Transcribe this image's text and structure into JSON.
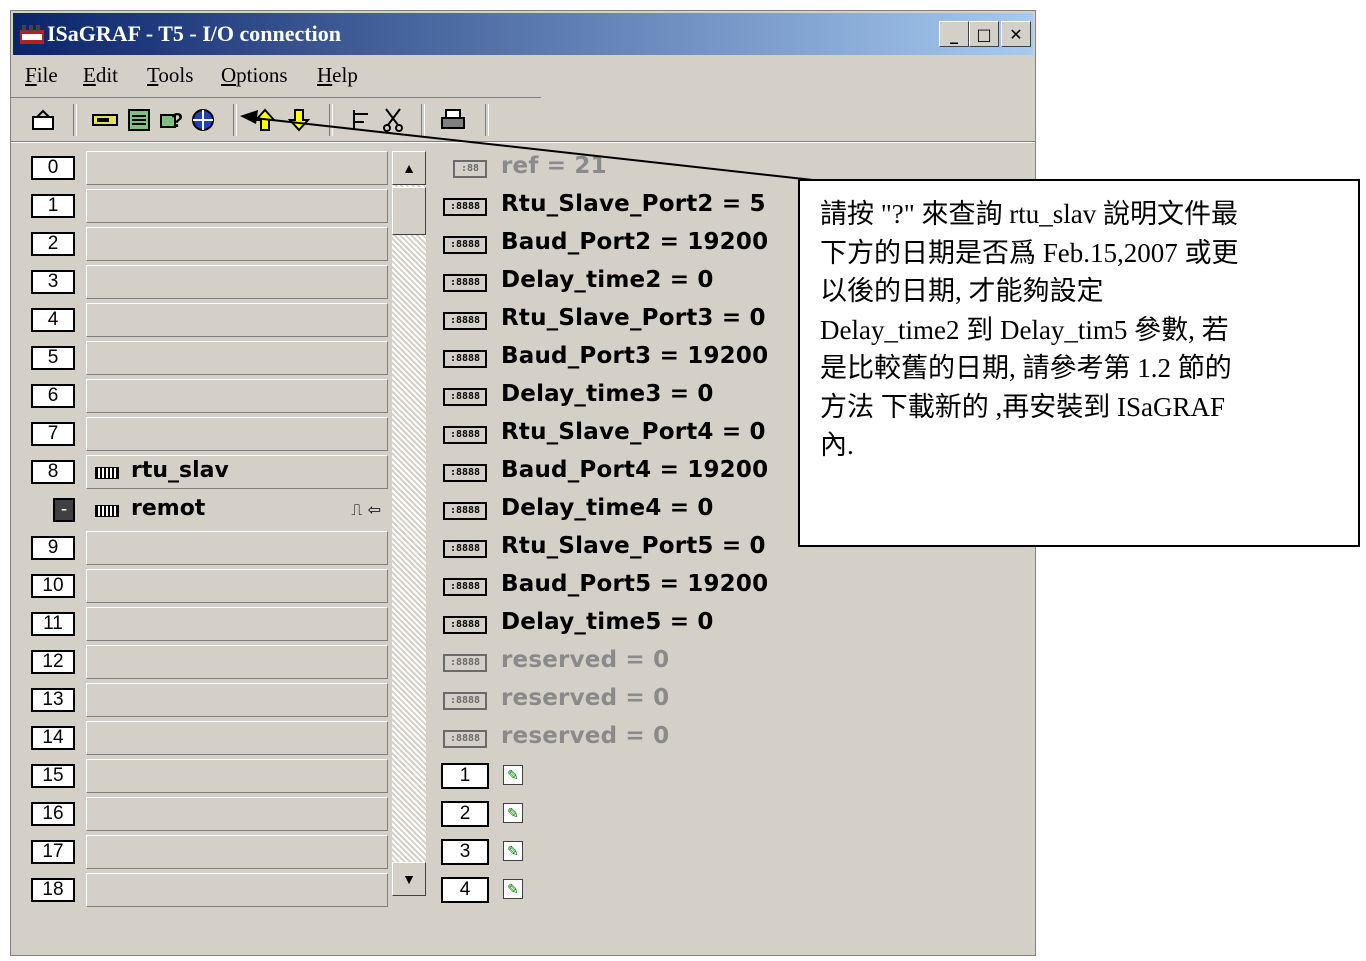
{
  "window": {
    "title": "ISaGRAF - T5 - I/O connection",
    "minimize": "_",
    "maximize": "□",
    "close": "✕"
  },
  "menu": [
    "File",
    "Edit",
    "Tools",
    "Options",
    "Help"
  ],
  "slots": [
    {
      "num": "0",
      "label": ""
    },
    {
      "num": "1",
      "label": ""
    },
    {
      "num": "2",
      "label": ""
    },
    {
      "num": "3",
      "label": ""
    },
    {
      "num": "4",
      "label": ""
    },
    {
      "num": "5",
      "label": ""
    },
    {
      "num": "6",
      "label": ""
    },
    {
      "num": "7",
      "label": ""
    },
    {
      "num": "8",
      "label": "rtu_slav"
    },
    {
      "num": "-",
      "label": "remot"
    },
    {
      "num": "9",
      "label": ""
    },
    {
      "num": "10",
      "label": ""
    },
    {
      "num": "11",
      "label": ""
    },
    {
      "num": "12",
      "label": ""
    },
    {
      "num": "13",
      "label": ""
    },
    {
      "num": "14",
      "label": ""
    },
    {
      "num": "15",
      "label": ""
    },
    {
      "num": "16",
      "label": ""
    },
    {
      "num": "17",
      "label": ""
    },
    {
      "num": "18",
      "label": ""
    }
  ],
  "params": [
    {
      "text": "ref = 21",
      "gray": true,
      "icon": ":88"
    },
    {
      "text": "Rtu_Slave_Port2 = 5",
      "gray": false,
      "icon": ":8888"
    },
    {
      "text": "Baud_Port2 = 19200",
      "gray": false,
      "icon": ":8888"
    },
    {
      "text": "Delay_time2 = 0",
      "gray": false,
      "icon": ":8888"
    },
    {
      "text": "Rtu_Slave_Port3 = 0",
      "gray": false,
      "icon": ":8888"
    },
    {
      "text": "Baud_Port3 = 19200",
      "gray": false,
      "icon": ":8888"
    },
    {
      "text": "Delay_time3 = 0",
      "gray": false,
      "icon": ":8888"
    },
    {
      "text": "Rtu_Slave_Port4 = 0",
      "gray": false,
      "icon": ":8888"
    },
    {
      "text": "Baud_Port4 = 19200",
      "gray": false,
      "icon": ":8888"
    },
    {
      "text": "Delay_time4 = 0",
      "gray": false,
      "icon": ":8888"
    },
    {
      "text": "Rtu_Slave_Port5 = 0",
      "gray": false,
      "icon": ":8888"
    },
    {
      "text": "Baud_Port5 = 19200",
      "gray": false,
      "icon": ":8888"
    },
    {
      "text": "Delay_time5 = 0",
      "gray": false,
      "icon": ":8888"
    },
    {
      "text": "reserved = 0",
      "gray": true,
      "icon": ":8888"
    },
    {
      "text": "reserved = 0",
      "gray": true,
      "icon": ":8888"
    },
    {
      "text": "reserved = 0",
      "gray": true,
      "icon": ":8888"
    }
  ],
  "channels": [
    "1",
    "2",
    "3",
    "4"
  ],
  "callout": {
    "lines": [
      "請按 \"?\" 來查詢 rtu_slav 說明文件最",
      "下方的日期是否爲 Feb.15,2007 或更",
      "以後的日期, 才能夠設定",
      "Delay_time2 到 Delay_tim5 參數, 若",
      "是比較舊的日期, 請參考第 1.2 節的",
      "方法 下載新的 ,再安裝到 ISaGRAF",
      "內."
    ]
  }
}
